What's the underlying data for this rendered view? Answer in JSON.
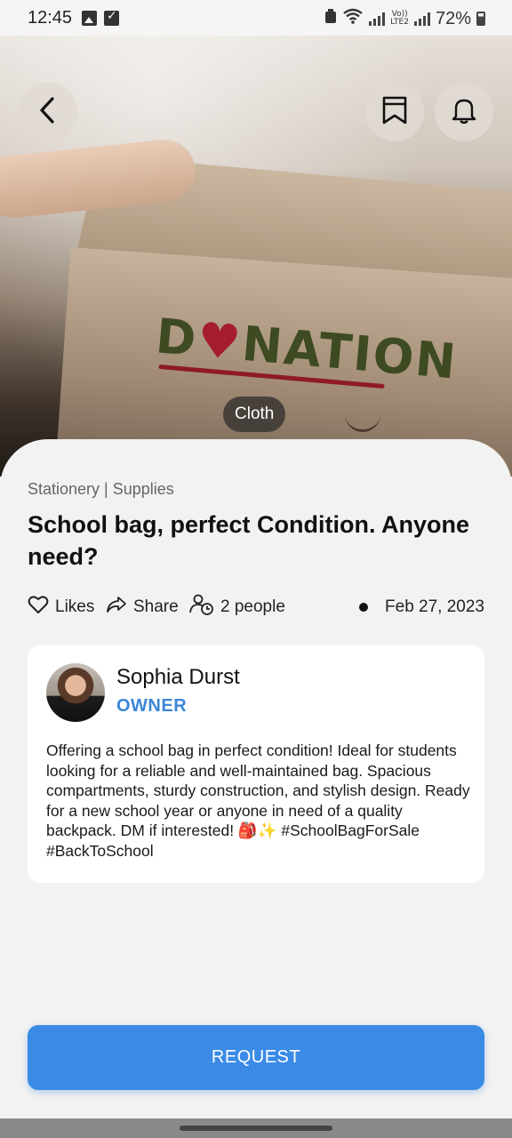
{
  "status_bar": {
    "time": "12:45",
    "network_label": "LTE2",
    "volte_label": "Vo))",
    "battery": "72%"
  },
  "hero": {
    "image_text": "DONATION",
    "category_chip": "Cloth",
    "icons": [
      "back-icon",
      "bookmark-icon",
      "bell-icon"
    ]
  },
  "post": {
    "tags": "Stationery | Supplies",
    "title": "School bag, perfect Condition. Anyone need?",
    "likes_label": "Likes",
    "share_label": "Share",
    "people_label": "2 people",
    "date": "Feb 27, 2023"
  },
  "owner": {
    "name": "Sophia Durst",
    "role": "OWNER",
    "description": "Offering a school bag in perfect condition! Ideal for students looking for a reliable and well-maintained bag. Spacious compartments, sturdy construction, and stylish design. Ready for a new school year or anyone in need of a quality backpack. DM if interested! 🎒✨ #SchoolBagForSale #BackToSchool"
  },
  "actions": {
    "request_label": "REQUEST"
  },
  "colors": {
    "accent": "#3a8ae6",
    "owner_role": "#3a86d6",
    "background": "#f2f2f2"
  }
}
